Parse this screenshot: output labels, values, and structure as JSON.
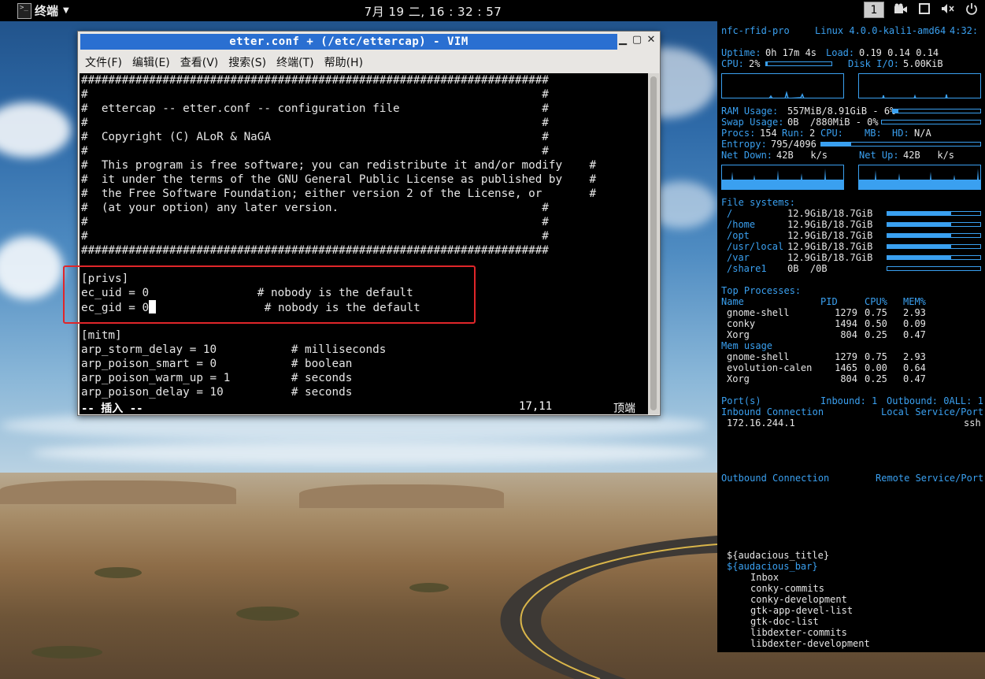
{
  "topbar": {
    "app_icon": "terminal-icon",
    "app_name": "终端",
    "clock": "7月 19 二, 16 : 32 : 57",
    "workspace": "1",
    "tray_icons": [
      "camera-icon",
      "screen-icon",
      "volume-muted-icon",
      "power-icon"
    ]
  },
  "vim": {
    "title": "etter.conf + (/etc/ettercap) - VIM",
    "menu": [
      "文件(F)",
      "编辑(E)",
      "查看(V)",
      "搜索(S)",
      "终端(T)",
      "帮助(H)"
    ],
    "lines": [
      "#####################################################################",
      "#                                                                   #",
      "#  ettercap -- etter.conf -- configuration file                     #",
      "#                                                                   #",
      "#  Copyright (C) ALoR & NaGA                                        #",
      "#                                                                   #",
      "#  This program is free software; you can redistribute it and/or modify    #",
      "#  it under the terms of the GNU General Public License as published by    #",
      "#  the Free Software Foundation; either version 2 of the License, or       #",
      "#  (at your option) any later version.                              #",
      "#                                                                   #",
      "#                                                                   #",
      "#####################################################################",
      "",
      "[privs]",
      "ec_uid = 0                # nobody is the default",
      "ec_gid = 0                # nobody is the default",
      "",
      "[mitm]",
      "arp_storm_delay = 10           # milliseconds",
      "arp_poison_smart = 0           # boolean",
      "arp_poison_warm_up = 1         # seconds",
      "arp_poison_delay = 10          # seconds"
    ],
    "cursor_line_prefix": "ec_gid = 0",
    "cursor_line_suffix": "                # nobody is the default",
    "status_mode": "-- 插入 --",
    "status_pos": "17,11",
    "status_scroll": "顶端"
  },
  "conky": {
    "host": "nfc-rfid-pro",
    "kernel": "Linux 4.0.0-kali1-amd64",
    "time": "4:32:",
    "uptime_label": "Uptime:",
    "uptime": "0h 17m 4s",
    "load_label": "Load:",
    "load": "0.19 0.14 0.14",
    "cpu_label": "CPU:",
    "cpu": "2%",
    "cpu_level": 0.02,
    "disk_label": "Disk I/O:",
    "disk": "5.00KiB",
    "ram_label": "RAM Usage:",
    "ram": "557MiB/8.91GiB - 6%",
    "ram_level": 0.06,
    "swap_label": "Swap Usage:",
    "swap": "0B  /880MiB - 0%",
    "procs_label": "Procs:",
    "procs": "154",
    "run_label": "Run:",
    "run": "2",
    "cpu_temp_label": "CPU:",
    "mb_label": "MB:",
    "hd_label": "HD:",
    "hd": "N/A",
    "entropy_label": "Entropy:",
    "entropy": "795/4096",
    "entropy_level": 0.19,
    "net_down_label": "Net Down:",
    "net_down": "42B   k/s",
    "net_up_label": "Net Up:",
    "net_up": "42B   k/s",
    "fs_label": "File systems:",
    "filesystems": [
      {
        "mount": "/",
        "usage": "12.9GiB/18.7GiB",
        "level": 0.69
      },
      {
        "mount": "/home",
        "usage": "12.9GiB/18.7GiB",
        "level": 0.69
      },
      {
        "mount": "/opt",
        "usage": "12.9GiB/18.7GiB",
        "level": 0.69
      },
      {
        "mount": "/usr/local",
        "usage": "12.9GiB/18.7GiB",
        "level": 0.69
      },
      {
        "mount": "/var",
        "usage": "12.9GiB/18.7GiB",
        "level": 0.69
      },
      {
        "mount": "/share1",
        "usage": "0B  /0B",
        "level": 0
      }
    ],
    "top_label": "Top Processes:",
    "proc_headers": [
      "Name",
      "PID",
      "CPU%",
      "MEM%"
    ],
    "top_procs": [
      [
        "gnome-shell",
        "1279",
        "0.75",
        "2.93"
      ],
      [
        "conky",
        "1494",
        "0.50",
        "0.09"
      ],
      [
        "Xorg",
        "804",
        "0.25",
        "0.47"
      ]
    ],
    "mem_label": "Mem usage",
    "mem_procs": [
      [
        "gnome-shell",
        "1279",
        "0.75",
        "2.93"
      ],
      [
        "evolution-calen",
        "1465",
        "0.00",
        "0.64"
      ],
      [
        "Xorg",
        "804",
        "0.25",
        "0.47"
      ]
    ],
    "ports_label": "Port(s)",
    "inbound_label": "Inbound: 1",
    "outbound_label": "Outbound: 0ALL: 1",
    "inbound_conn_label": "Inbound Connection",
    "local_service_label": "Local Service/Port",
    "inbound_ip": "172.16.244.1",
    "inbound_service": "ssh",
    "outbound_conn_label": "Outbound Connection",
    "remote_service_label": "Remote Service/Port",
    "audacious_title": "${audacious_title}",
    "audacious_bar": "${audacious_bar}",
    "mail_folders": [
      "Inbox",
      "conky-commits",
      "conky-development",
      "gtk-app-devel-list",
      "gtk-doc-list",
      "libdexter-commits",
      "libdexter-development"
    ]
  },
  "colors": {
    "conky_accent": "#3aa0f0",
    "title_bar": "#2a6fd1",
    "highlight_box": "#e0262a"
  }
}
